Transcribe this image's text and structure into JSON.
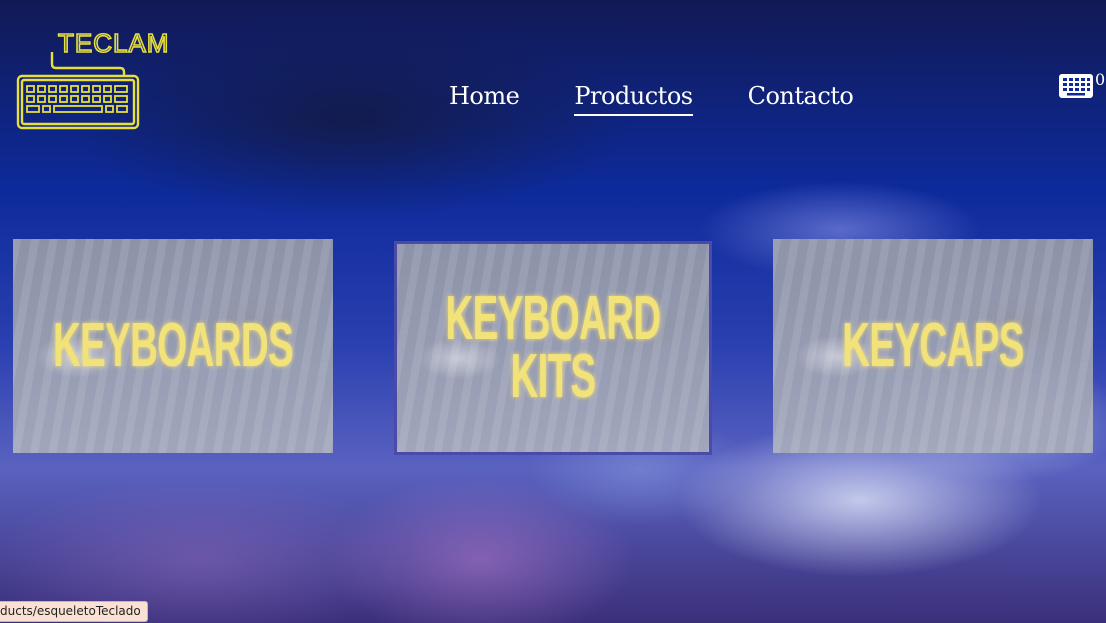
{
  "header": {
    "brand": "TECLAM",
    "nav": [
      {
        "label": "Home",
        "active": false
      },
      {
        "label": "Productos",
        "active": true
      },
      {
        "label": "Contacto",
        "active": false
      }
    ],
    "cart": {
      "icon": "keyboard-icon",
      "count": "0"
    }
  },
  "categories": [
    {
      "label": "KEYBOARDS"
    },
    {
      "label": "KEYBOARD\nKITS"
    },
    {
      "label": "KEYCAPS"
    }
  ],
  "status_bar": {
    "url": "ducts/esqueletoTeclado"
  },
  "colors": {
    "accent": "#e6df3c",
    "text": "#ffffff",
    "card_text": "#f2e27a"
  }
}
